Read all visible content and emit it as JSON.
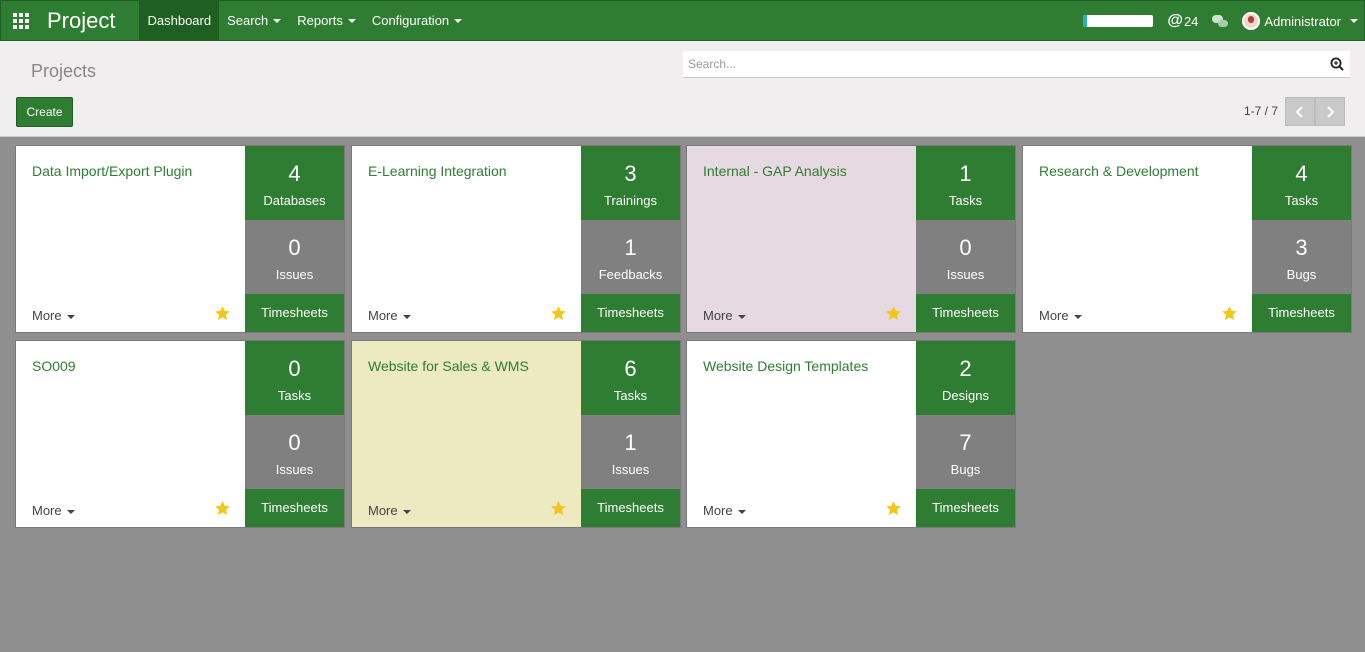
{
  "nav": {
    "app_title": "Project",
    "menu": [
      {
        "label": "Dashboard"
      },
      {
        "label": "Search"
      },
      {
        "label": "Reports"
      },
      {
        "label": "Configuration"
      }
    ],
    "progress_fraction": 0.05,
    "mentions_count": "24",
    "user_name": "Administrator"
  },
  "control": {
    "breadcrumb": "Projects",
    "search_placeholder": "Search...",
    "create_label": "Create",
    "pager": "1-7 / 7"
  },
  "colors": {
    "brand": "#2f7d32",
    "stat_gray": "#808080",
    "star": "#f5c518",
    "card_pink": "#e6d9e2",
    "card_yellow": "#ede9c1"
  },
  "projects": [
    {
      "name": "Data Import/Export Plugin",
      "bg": "#ffffff",
      "top": {
        "count": "4",
        "label": "Databases"
      },
      "mid": {
        "count": "0",
        "label": "Issues"
      },
      "timesheets_label": "Timesheets",
      "more_label": "More"
    },
    {
      "name": "E-Learning Integration",
      "bg": "#ffffff",
      "top": {
        "count": "3",
        "label": "Trainings"
      },
      "mid": {
        "count": "1",
        "label": "Feedbacks"
      },
      "timesheets_label": "Timesheets",
      "more_label": "More"
    },
    {
      "name": "Internal - GAP Analysis",
      "bg": "#e6d9e2",
      "top": {
        "count": "1",
        "label": "Tasks"
      },
      "mid": {
        "count": "0",
        "label": "Issues"
      },
      "timesheets_label": "Timesheets",
      "more_label": "More"
    },
    {
      "name": "Research & Development",
      "bg": "#ffffff",
      "top": {
        "count": "4",
        "label": "Tasks"
      },
      "mid": {
        "count": "3",
        "label": "Bugs"
      },
      "timesheets_label": "Timesheets",
      "more_label": "More"
    },
    {
      "name": "SO009",
      "bg": "#ffffff",
      "top": {
        "count": "0",
        "label": "Tasks"
      },
      "mid": {
        "count": "0",
        "label": "Issues"
      },
      "timesheets_label": "Timesheets",
      "more_label": "More"
    },
    {
      "name": "Website for Sales & WMS",
      "bg": "#ede9c1",
      "top": {
        "count": "6",
        "label": "Tasks"
      },
      "mid": {
        "count": "1",
        "label": "Issues"
      },
      "timesheets_label": "Timesheets",
      "more_label": "More"
    },
    {
      "name": "Website Design Templates",
      "bg": "#ffffff",
      "top": {
        "count": "2",
        "label": "Designs"
      },
      "mid": {
        "count": "7",
        "label": "Bugs"
      },
      "timesheets_label": "Timesheets",
      "more_label": "More"
    }
  ]
}
